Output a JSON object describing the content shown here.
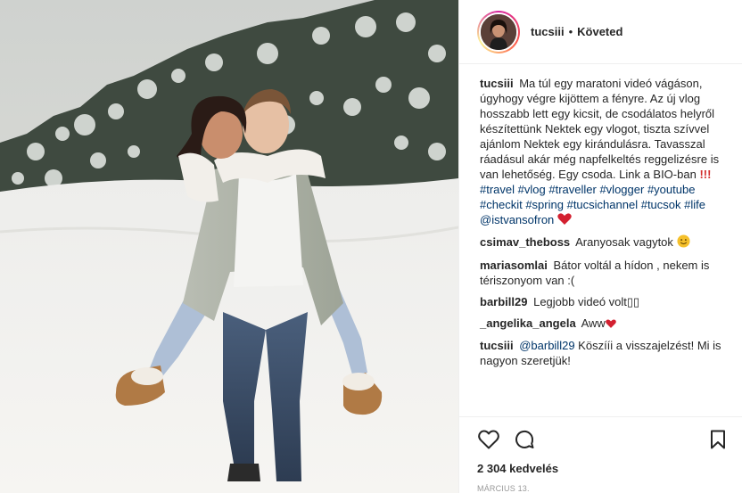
{
  "post": {
    "username": "tucsiii",
    "separator": "•",
    "follow_status": "Követed"
  },
  "caption": {
    "username": "tucsiii",
    "text": "Ma túl egy maratoni videó vágáson, úgyhogy végre kijöttem a fényre. Az új vlog hosszabb lett egy kicsit, de csodálatos helyről készítettünk Nektek egy vlogot, tiszta szívvel ajánlom Nektek egy kirándulásra. Tavasszal ráadásul akár még napfelkeltés reggelizésre is van lehetőség. Egy csoda. Link a BIO-ban",
    "emoji": "!!!",
    "hashtags": [
      "#travel",
      "#vlog",
      "#traveller",
      "#vlogger",
      "#youtube",
      "#checkit",
      "#spring",
      "#tucsichannel",
      "#tucsok",
      "#life"
    ],
    "mention": "@istvansofron",
    "trailing_emoji_icon": "red-heart-icon"
  },
  "comments": [
    {
      "username": "csimav_theboss",
      "text": "Aranyosak vagytok",
      "emoji_icon": "smiling-face-icon"
    },
    {
      "username": "mariasomlai",
      "text": "Bátor voltál a hídon , nekem is tériszonyom van :("
    },
    {
      "username": "barbill29",
      "text": "Legjobb videó volt",
      "emoji_placeholder": "▯▯"
    },
    {
      "username": "_angelika_angela",
      "text": "Aww",
      "emoji_icon": "red-heart-icon"
    },
    {
      "username": "tucsiii",
      "mention": "@barbill29",
      "text": "Köszííi a visszajelzést! Mi is nagyon szeretjük!"
    }
  ],
  "actions": {
    "icons": [
      "heart-outline-icon",
      "comment-bubble-icon",
      "bookmark-icon"
    ],
    "likes": "2 304 kedvelés",
    "date": "MÁRCIUS 13."
  },
  "colors": {
    "text": "#262626",
    "link": "#003569",
    "muted": "#999999",
    "border": "#efefef",
    "heart_red": "#e0245e"
  }
}
